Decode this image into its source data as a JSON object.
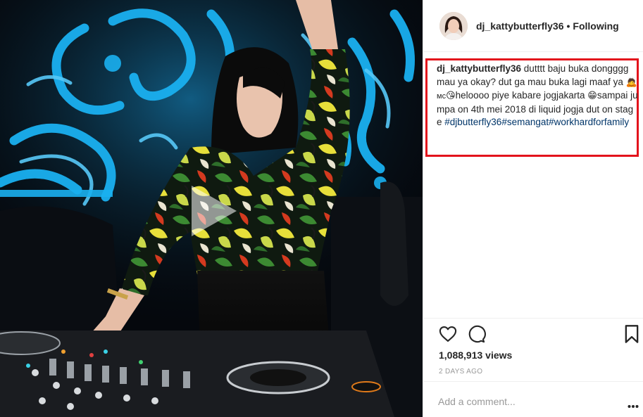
{
  "header": {
    "username": "dj_kattybutterfly36",
    "separator": "•",
    "follow_status": "Following"
  },
  "caption": {
    "username": "dj_kattybutterfly36",
    "part1": " dutttt baju buka dongggg mau ya okay? dut ga mau buka lagi maaf ya ",
    "emoji1": "🙇",
    "mc": "ᴍᴄ",
    "emoji2": "😘",
    "part2": "heloooo piye kabare jogjakarta ",
    "emoji3": "😁",
    "part3": "sampai jumpa on 4th mei 2018 di liquid jogja dut on stage ",
    "hashtags": "#djbutterfly36#semangat#workhardforfamily"
  },
  "stats": {
    "views": "1,088,913 views",
    "time_ago": "2 DAYS AGO"
  },
  "comment": {
    "placeholder": "Add a comment..."
  },
  "icons": {
    "like": "heart-icon",
    "comment": "speech-bubble-icon",
    "save": "bookmark-icon",
    "more": "ellipsis-icon",
    "play": "play-icon"
  },
  "colors": {
    "highlight_border": "#e3131c",
    "hashtag": "#003569",
    "stage_blue": "#1aa3e6"
  }
}
